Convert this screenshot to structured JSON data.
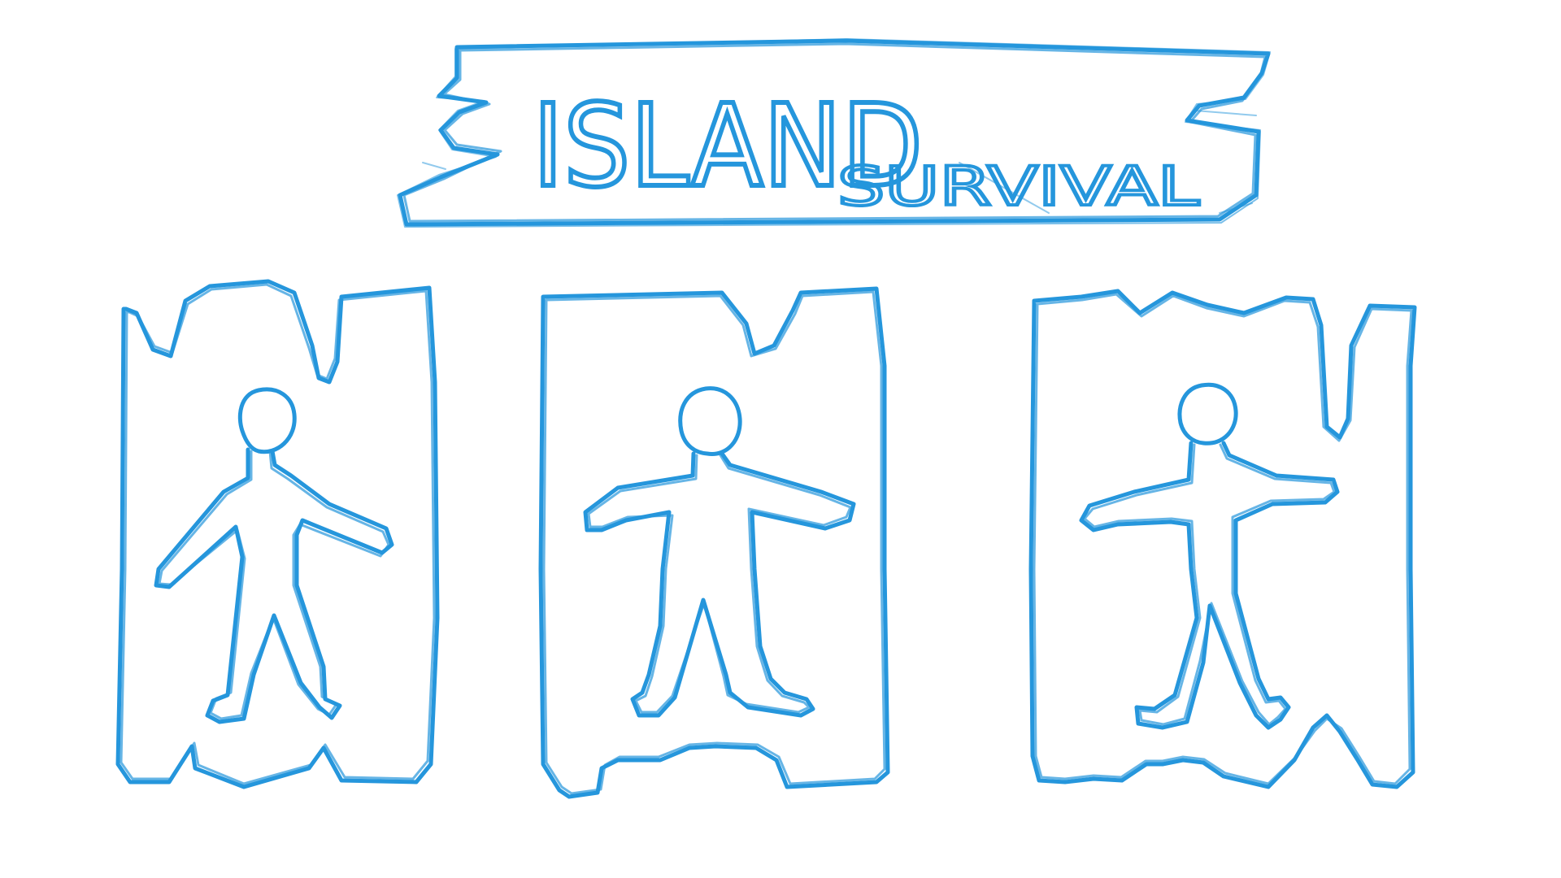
{
  "title_sign": {
    "line1": "ISLAND",
    "line2": "SURVIVAL"
  },
  "characters": [
    {
      "id": "character-1",
      "pose": "arms-down"
    },
    {
      "id": "character-2",
      "pose": "arms-out"
    },
    {
      "id": "character-3",
      "pose": "arms-out"
    }
  ],
  "colors": {
    "ink": "#2596dc",
    "background": "#ffffff"
  }
}
